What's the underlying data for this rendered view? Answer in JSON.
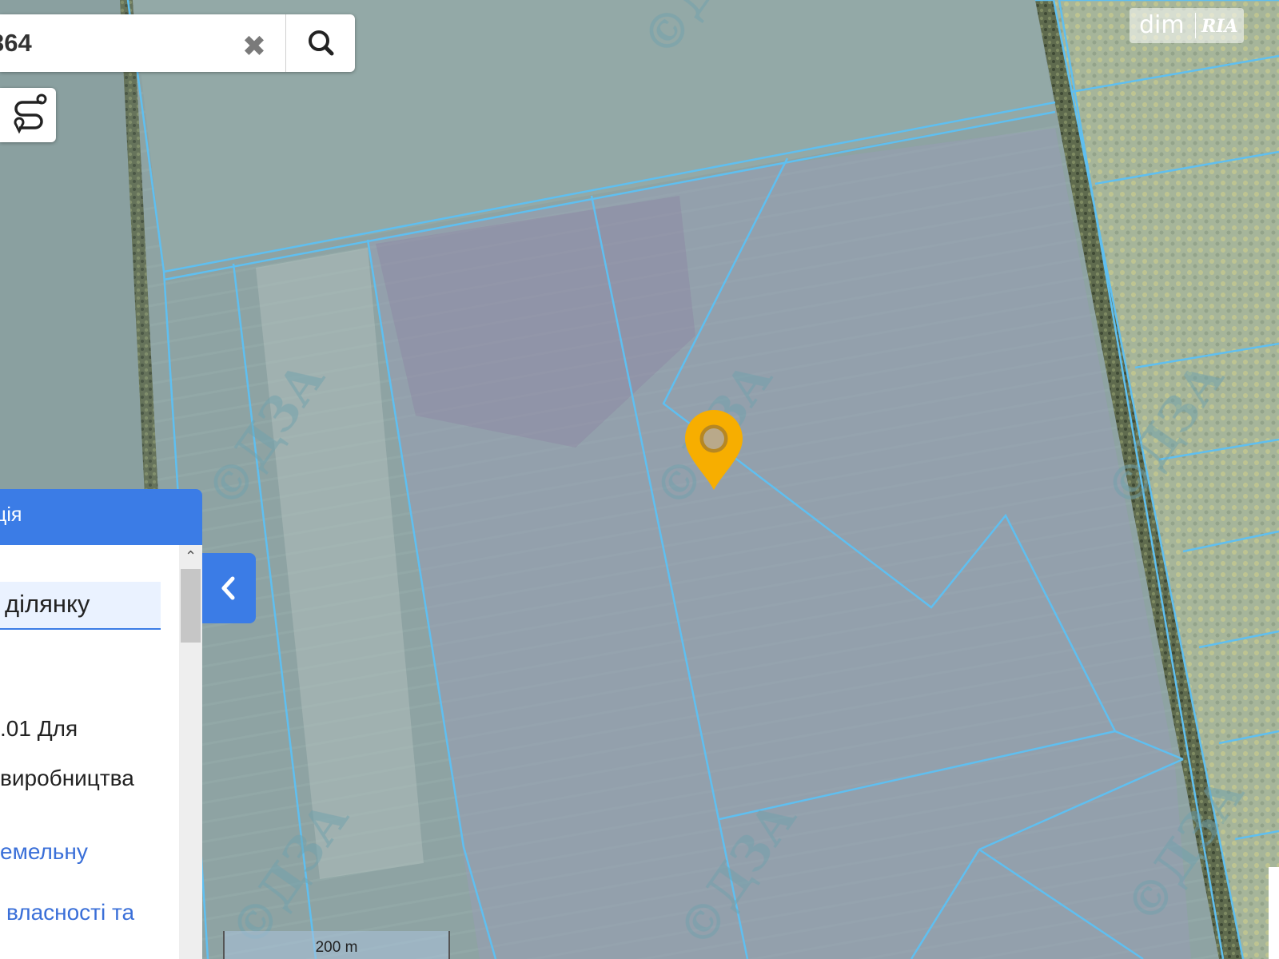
{
  "search": {
    "value": "364"
  },
  "logo": {
    "text_left": "dim",
    "text_right": "RIA"
  },
  "watermark": {
    "text": "©ДЗА"
  },
  "panel": {
    "title": "ція",
    "field_value": "ділянку",
    "lines": [
      ".01 Для",
      "виробництва"
    ],
    "links": [
      "емельну",
      "власності та"
    ]
  },
  "scale": {
    "label": "200 m"
  },
  "colors": {
    "accent": "#3b7ce6",
    "parcel_line": "#5fbff0",
    "marker": "#f7ae00",
    "link": "#3a6fd8"
  },
  "icons": {
    "clear": "close-icon",
    "search": "search-icon",
    "route": "route-icon",
    "marker": "location-pin-icon",
    "toggle": "chevron-left-icon"
  }
}
